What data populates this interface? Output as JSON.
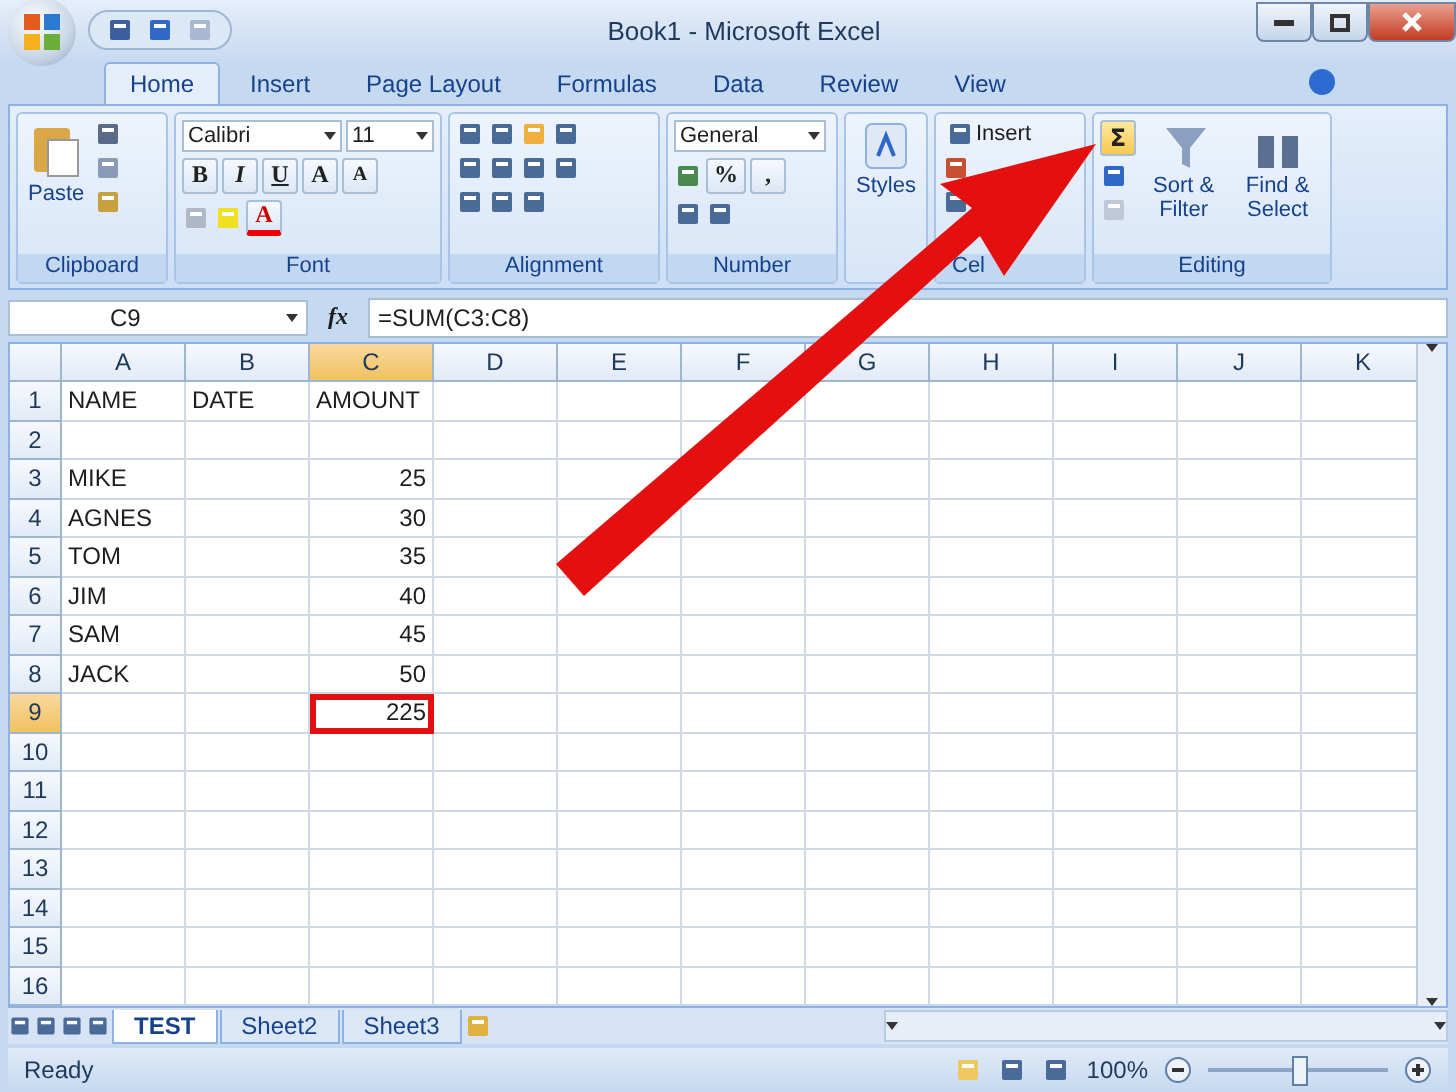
{
  "window": {
    "title": "Book1 - Microsoft Excel"
  },
  "tabs": [
    {
      "label": "Home",
      "selected": true
    },
    {
      "label": "Insert",
      "selected": false
    },
    {
      "label": "Page Layout",
      "selected": false
    },
    {
      "label": "Formulas",
      "selected": false
    },
    {
      "label": "Data",
      "selected": false
    },
    {
      "label": "Review",
      "selected": false
    },
    {
      "label": "View",
      "selected": false
    }
  ],
  "ribbon": {
    "clipboard": {
      "paste": "Paste",
      "label": "Clipboard"
    },
    "font": {
      "name": "Calibri",
      "size": "11",
      "bold": "B",
      "italic": "I",
      "underline": "U",
      "grow": "A",
      "shrink": "A",
      "font_color_button": "A",
      "label": "Font"
    },
    "alignment": {
      "label": "Alignment"
    },
    "number": {
      "format": "General",
      "percent": "%",
      "comma": ",",
      "label": "Number"
    },
    "styles": {
      "label": "Styles"
    },
    "cells": {
      "insert": "Insert",
      "label": "Cel"
    },
    "editing": {
      "autosum": "Σ",
      "autosum_selected": true,
      "sort": "Sort & Filter",
      "find": "Find & Select",
      "label": "Editing"
    }
  },
  "formula_bar": {
    "name_box": "C9",
    "fx": "fx",
    "formula": "=SUM(C3:C8)"
  },
  "columns": [
    {
      "label": "A",
      "selected": false
    },
    {
      "label": "B",
      "selected": false
    },
    {
      "label": "C",
      "selected": true
    },
    {
      "label": "D",
      "selected": false
    },
    {
      "label": "E",
      "selected": false
    },
    {
      "label": "F",
      "selected": false
    },
    {
      "label": "G",
      "selected": false
    },
    {
      "label": "H",
      "selected": false
    },
    {
      "label": "I",
      "selected": false
    },
    {
      "label": "J",
      "selected": false
    },
    {
      "label": "K",
      "selected": false
    }
  ],
  "rows": [
    {
      "label": "1",
      "selected": false,
      "cells": [
        "NAME",
        "DATE",
        "AMOUNT"
      ]
    },
    {
      "label": "2",
      "selected": false,
      "cells": []
    },
    {
      "label": "3",
      "selected": false,
      "cells": [
        "MIKE",
        "",
        "25"
      ]
    },
    {
      "label": "4",
      "selected": false,
      "cells": [
        "AGNES",
        "",
        "30"
      ]
    },
    {
      "label": "5",
      "selected": false,
      "cells": [
        "TOM",
        "",
        "35"
      ]
    },
    {
      "label": "6",
      "selected": false,
      "cells": [
        "JIM",
        "",
        "40"
      ]
    },
    {
      "label": "7",
      "selected": false,
      "cells": [
        "SAM",
        "",
        "45"
      ]
    },
    {
      "label": "8",
      "selected": false,
      "cells": [
        "JACK",
        "",
        "50"
      ]
    },
    {
      "label": "9",
      "selected": true,
      "cells": [
        "",
        "",
        "225"
      ]
    },
    {
      "label": "10",
      "selected": false,
      "cells": []
    },
    {
      "label": "11",
      "selected": false,
      "cells": []
    },
    {
      "label": "12",
      "selected": false,
      "cells": []
    },
    {
      "label": "13",
      "selected": false,
      "cells": []
    },
    {
      "label": "14",
      "selected": false,
      "cells": []
    },
    {
      "label": "15",
      "selected": false,
      "cells": []
    },
    {
      "label": "16",
      "selected": false,
      "cells": []
    }
  ],
  "sheets": [
    {
      "label": "TEST",
      "selected": true
    },
    {
      "label": "Sheet2",
      "selected": false
    },
    {
      "label": "Sheet3",
      "selected": false
    }
  ],
  "status_bar": {
    "status": "Ready",
    "zoom": "100%",
    "zoom_slider": {
      "level": 0.5
    }
  }
}
